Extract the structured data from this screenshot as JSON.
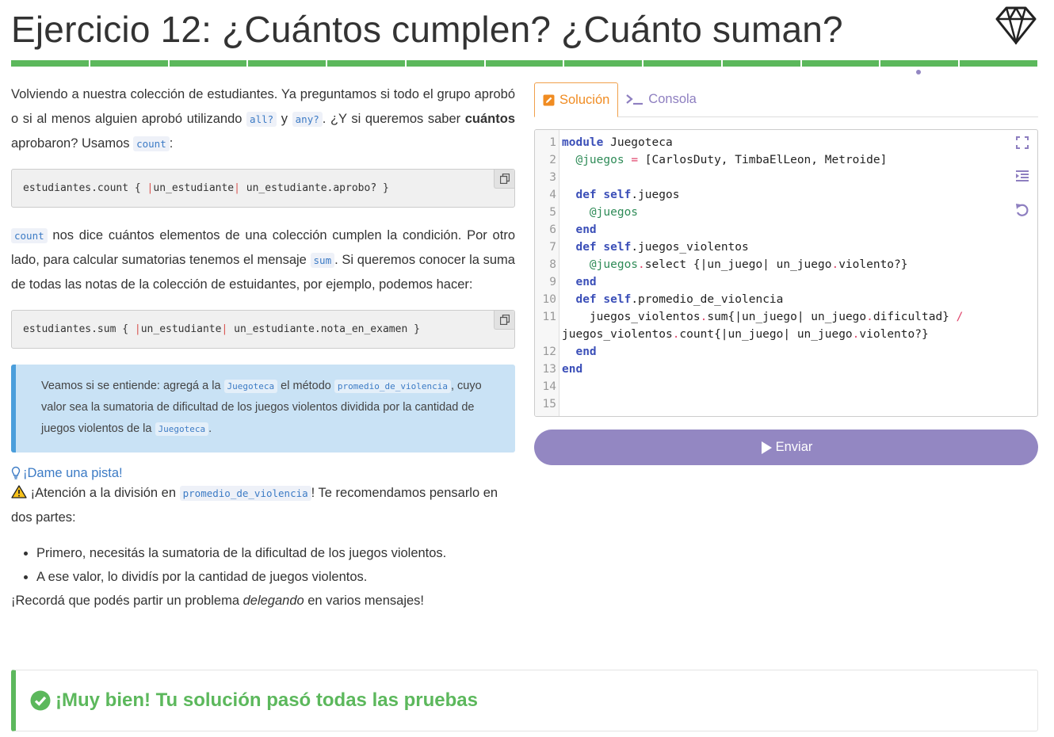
{
  "header": {
    "title": "Ejercicio 12: ¿Cuántos cumplen? ¿Cuánto suman?",
    "logo_icon": "ruby-gem-icon",
    "progress_segments": 13,
    "progress_color": "#5cb85c",
    "current_marker_color": "#9387c2"
  },
  "content": {
    "p1": {
      "t1": "Volviendo a nuestra colección de estudiantes. Ya preguntamos si todo el grupo aprobó o si al menos alguien aprobó utilizando ",
      "c1": "all?",
      "t2": " y ",
      "c2": "any?",
      "t3": ". ¿Y si queremos saber ",
      "strong": "cuántos",
      "t4": " aprobaron? Usamos ",
      "c3": "count",
      "t5": ":"
    },
    "code1": {
      "a": "estudiantes.count { ",
      "p1": "|",
      "b": "un_estudiante",
      "p2": "|",
      "c": " un_estudiante.aprobo? }"
    },
    "p2": {
      "c1": "count",
      "t1": " nos dice cuántos elementos de una colección cumplen la condición. Por otro lado, para calcular sumatorias tenemos el mensaje ",
      "c2": "sum",
      "t2": ". Si queremos conocer la suma de todas las notas de la colección de estuidantes, por ejemplo, podemos hacer:"
    },
    "code2": {
      "a": "estudiantes.sum { ",
      "p1": "|",
      "b": "un_estudiante",
      "p2": "|",
      "c": " un_estudiante.nota_en_examen }"
    },
    "notice": {
      "t1": "Veamos si se entiende: agregá a la ",
      "c1": "Juegoteca",
      "t2": " el método ",
      "c2": "promedio_de_violencia",
      "t3": ", cuyo valor sea la sumatoria de dificultad de los juegos violentos dividida por la cantidad de juegos violentos de la ",
      "c3": "Juegoteca",
      "t4": "."
    },
    "hint": "¡Dame una pista!",
    "warning": {
      "t1": "¡Atención a la división en ",
      "c1": "promedio_de_violencia",
      "t2": "! Te recomendamos pensarlo en dos partes:"
    },
    "list": [
      "Primero, necesitás la sumatoria de la dificultad de los juegos violentos.",
      "A ese valor, lo dividís por la cantidad de juegos violentos."
    ],
    "final": {
      "t1": "¡Recordá que podés partir un problema ",
      "em": "delegando",
      "t2": " en varios mensajes!"
    }
  },
  "tabs": {
    "solution": "Solución",
    "console": "Consola"
  },
  "editor": {
    "line_numbers": [
      "1",
      "2",
      "3",
      "4",
      "5",
      "6",
      "7",
      "8",
      "9",
      "10",
      "11",
      "12",
      "13",
      "14",
      "15"
    ]
  },
  "submit_label": "Enviar",
  "success_message": "¡Muy bien! Tu solución pasó todas las pruebas"
}
